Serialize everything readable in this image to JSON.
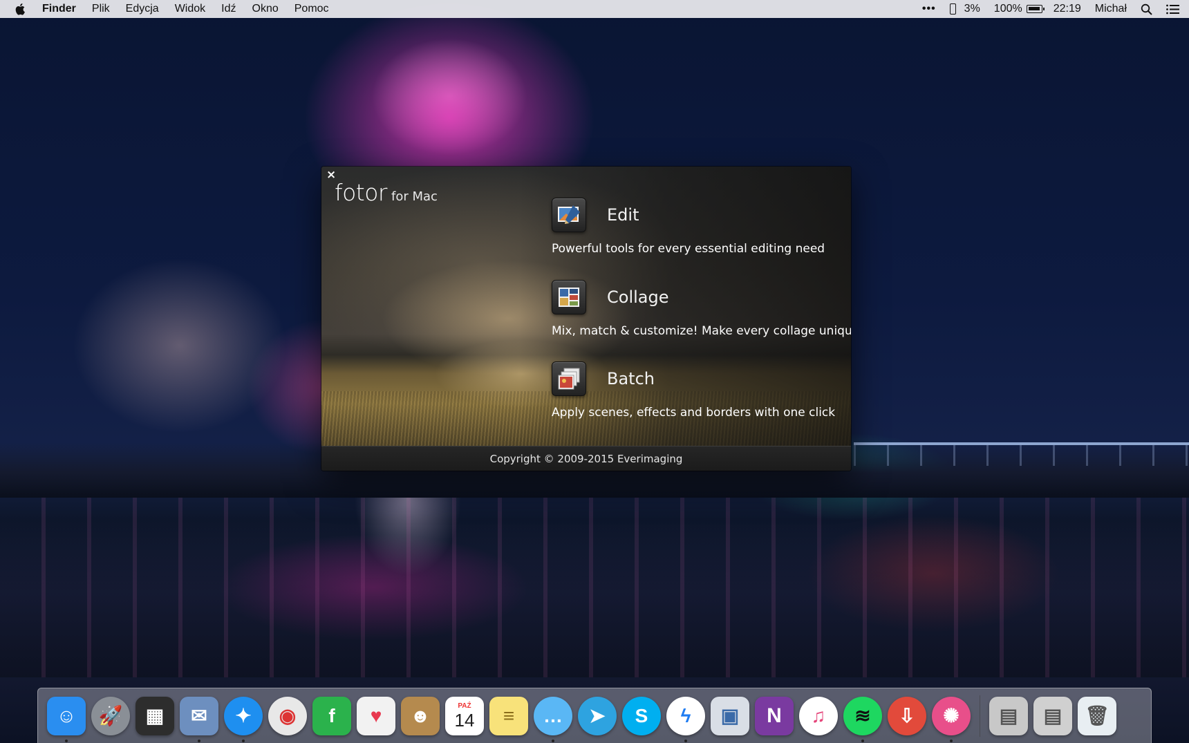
{
  "menubar": {
    "app_name": "Finder",
    "menus": [
      "Plik",
      "Edycja",
      "Widok",
      "Idź",
      "Okno",
      "Pomoc"
    ],
    "status": {
      "dots": "•••",
      "phone_battery": "3%",
      "battery": "100%",
      "clock": "22:19",
      "user": "Michał"
    }
  },
  "fotor": {
    "brand_name": "fotor",
    "brand_sub": "for Mac",
    "close_glyph": "×",
    "features": [
      {
        "title": "Edit",
        "description": "Powerful tools for every essential editing need",
        "icon": "edit-icon"
      },
      {
        "title": "Collage",
        "description": "Mix, match & customize! Make every collage unique",
        "icon": "collage-icon"
      },
      {
        "title": "Batch",
        "description": "Apply scenes, effects and borders with one click",
        "icon": "batch-icon"
      }
    ],
    "copyright": "Copyright © 2009-2015 Everimaging"
  },
  "dock": {
    "items": [
      {
        "icon": "finder-icon",
        "color": "#2a8ef0",
        "running": true
      },
      {
        "icon": "launchpad-icon",
        "color": "#8a8f96",
        "running": false
      },
      {
        "icon": "mission-control-icon",
        "color": "#2d2d2d",
        "running": false
      },
      {
        "icon": "mail-stamp-icon",
        "color": "#6d8fbf",
        "running": true
      },
      {
        "icon": "safari-icon",
        "color": "#1e8ff0",
        "running": true
      },
      {
        "icon": "chrome-icon",
        "color": "#e8e8e8",
        "running": false
      },
      {
        "icon": "feedly-icon",
        "color": "#2bb24c",
        "running": false
      },
      {
        "icon": "pocket-icon",
        "color": "#f2f2f2",
        "running": false
      },
      {
        "icon": "contacts-icon",
        "color": "#b58a4e",
        "running": false
      },
      {
        "icon": "calendar-icon",
        "color": "#ffffff",
        "running": false
      },
      {
        "icon": "notes-icon",
        "color": "#f8e27a",
        "running": false
      },
      {
        "icon": "messages-icon",
        "color": "#5ab7f5",
        "running": true
      },
      {
        "icon": "telegram-icon",
        "color": "#2ea3e0",
        "running": false
      },
      {
        "icon": "skype-icon",
        "color": "#00aff0",
        "running": false
      },
      {
        "icon": "messenger-icon",
        "color": "#ffffff",
        "running": true
      },
      {
        "icon": "preview-icon",
        "color": "#d9dee6",
        "running": false
      },
      {
        "icon": "onenote-icon",
        "color": "#7a3aa0",
        "running": false
      },
      {
        "icon": "itunes-icon",
        "color": "#ffffff",
        "running": false
      },
      {
        "icon": "spotify-icon",
        "color": "#1ed760",
        "running": true
      },
      {
        "icon": "transmit-icon",
        "color": "#e24a3b",
        "running": false
      },
      {
        "icon": "fotor-icon",
        "color": "#e84f8a",
        "running": true
      }
    ],
    "calendar": {
      "month": "PAŹ",
      "day": "14"
    },
    "onenote_letter": "N",
    "trailing": [
      {
        "icon": "documents-stack-icon",
        "color": "#c8c8c8"
      },
      {
        "icon": "downloads-stack-icon",
        "color": "#d0d0d0"
      },
      {
        "icon": "trash-icon",
        "color": "#e8eef2"
      }
    ]
  }
}
